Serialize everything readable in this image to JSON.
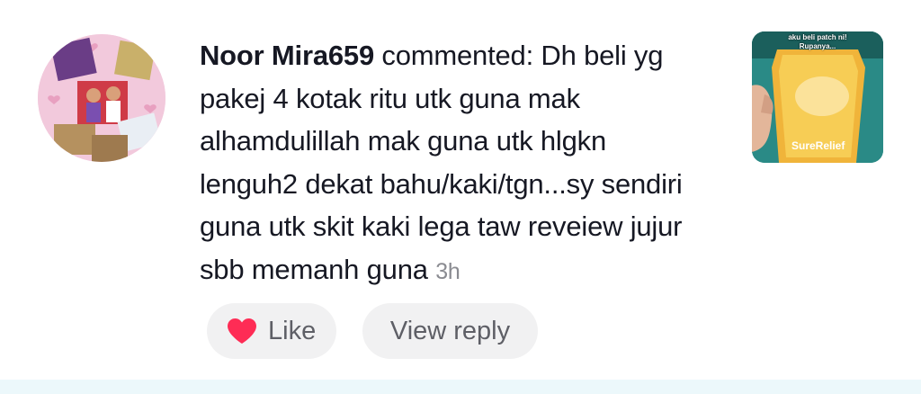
{
  "comment": {
    "username": "Noor Mira659",
    "verb": "commented:",
    "text": "Dh beli yg pakej 4 kotak ritu utk guna mak alhamdulillah mak guna utk hlgkn lenguh2 dekat bahu/kaki/tgn...sy sendiri guna utk skit kaki lega taw reveiew jujur sbb memanh guna",
    "timestamp": "3h"
  },
  "thumbnail": {
    "caption": "aku beli patch ni!\nRupanya...",
    "product": "SureRelief"
  },
  "actions": {
    "like_label": "Like",
    "view_reply_label": "View reply"
  },
  "colors": {
    "heart": "#fe2c55",
    "text": "#161823",
    "muted": "#8a8b91",
    "pill_bg": "#f1f1f2"
  },
  "icons": {
    "like": "heart-icon"
  }
}
